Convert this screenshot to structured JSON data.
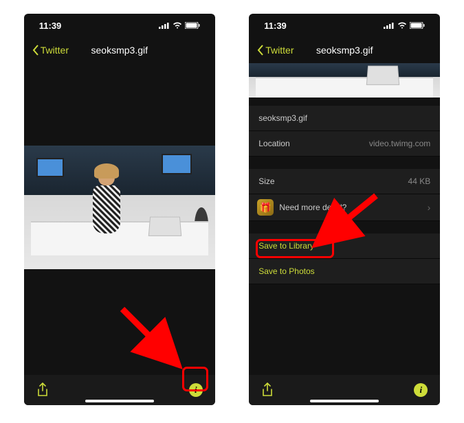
{
  "left": {
    "status": {
      "time": "11:39"
    },
    "nav": {
      "back_label": "Twitter",
      "title": "seoksmp3.gif"
    }
  },
  "right": {
    "status": {
      "time": "11:39"
    },
    "nav": {
      "back_label": "Twitter",
      "title": "seoksmp3.gif"
    },
    "details": {
      "filename": "seoksmp3.gif",
      "location_label": "Location",
      "location_value": "video.twimg.com",
      "size_label": "Size",
      "size_value": "44 KB",
      "more_detail_label": "Need more detail?",
      "save_library_label": "Save to Library",
      "save_photos_label": "Save to Photos"
    }
  },
  "colors": {
    "accent": "#cddc39",
    "highlight": "#ff0000"
  }
}
